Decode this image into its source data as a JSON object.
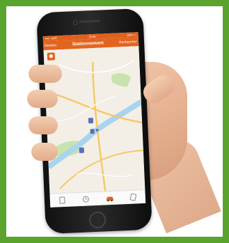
{
  "statusbar": {
    "carrier": "••••○ SFR",
    "time": "10:45",
    "battery": "84% ▭"
  },
  "navbar": {
    "left": "Rendez",
    "title": "Stationnement",
    "right": "Rechercher"
  },
  "map": {
    "water_color": "#a9d4ee",
    "park_color": "#c8e3b0",
    "road_color": "#f6c86a",
    "accent_color": "#e2651f"
  },
  "tabbar": {
    "icons": [
      "meter-icon",
      "clock-icon",
      "car-icon",
      "ticket-icon"
    ]
  }
}
